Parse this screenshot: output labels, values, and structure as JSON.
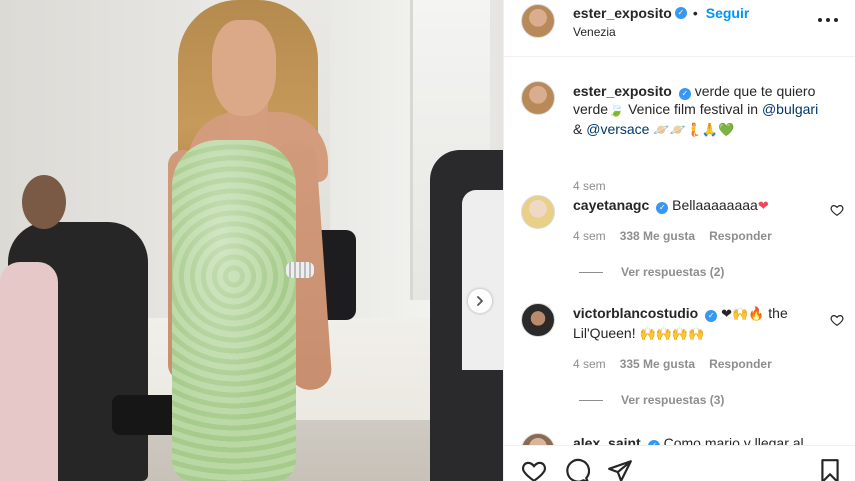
{
  "post": {
    "username": "ester_exposito",
    "follow_label": "Seguir",
    "dot": "•",
    "location": "Venezia"
  },
  "caption": {
    "username": "ester_exposito",
    "text_1": "verde que te quiero verde",
    "text_2": " Venice film festival in ",
    "mention_1": "@bulgari",
    "amp": " & ",
    "mention_2": "@versace",
    "emojis": "🪐🪐🧜🙏💚",
    "leaf_emoji": "🍃",
    "time": "4 sem"
  },
  "comments": [
    {
      "username": "cayetanagc",
      "text": "Bellaaaaaaaa",
      "text_emoji": "❤",
      "time": "4 sem",
      "likes": "338 Me gusta",
      "reply_label": "Responder",
      "view_replies": "Ver respuestas (2)"
    },
    {
      "username": "victorblancostudio",
      "text_emoji_1": "❤🙌🔥",
      "text": " the Lil'Queen! ",
      "text_emoji_2": "🙌🙌🙌🙌",
      "time": "4 sem",
      "likes": "335 Me gusta",
      "reply_label": "Responder",
      "view_replies": "Ver respuestas (3)"
    },
    {
      "username": "alex_saint",
      "text": "Como mario y llegar al"
    }
  ],
  "colors": {
    "accent": "#0095f6",
    "verified": "#3897f0",
    "heart": "#ed4956",
    "mention": "#00376b",
    "muted": "#8e8e8e"
  },
  "icons": {
    "more": "more-options-icon",
    "verified": "verified-badge-icon",
    "like": "heart-outline-icon",
    "comment": "comment-bubble-icon",
    "share": "paper-plane-icon",
    "save": "bookmark-icon",
    "next": "chevron-right-icon"
  }
}
